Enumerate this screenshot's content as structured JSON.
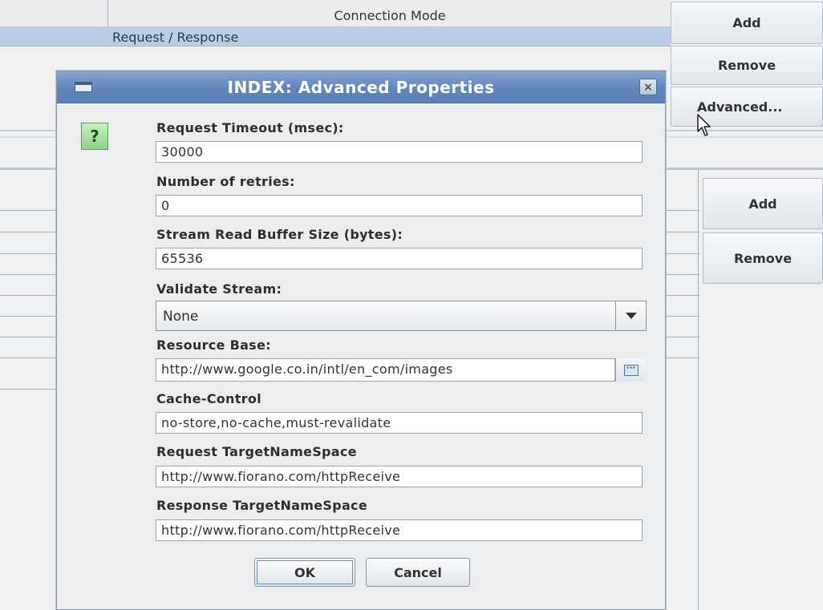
{
  "background": {
    "table": {
      "column_header": "Connection Mode",
      "selected_row_value": "Request / Response"
    },
    "top_buttons": {
      "add": "Add",
      "remove": "Remove",
      "advanced": "Advanced..."
    },
    "lower_buttons": {
      "add": "Add",
      "remove": "Remove"
    }
  },
  "dialog": {
    "title": "INDEX: Advanced Properties",
    "close_glyph": "×",
    "question_glyph": "?",
    "fields": {
      "request_timeout": {
        "label": "Request Timeout (msec):",
        "value": "30000"
      },
      "retries": {
        "label": "Number of retries:",
        "value": "0"
      },
      "buffer_size": {
        "label": "Stream Read Buffer Size (bytes):",
        "value": "65536"
      },
      "validate_stream": {
        "label": "Validate Stream:",
        "selected": "None"
      },
      "resource_base": {
        "label": "Resource Base:",
        "value": "http://www.google.co.in/intl/en_com/images",
        "browse_glyph": "···"
      },
      "cache_control": {
        "label": "Cache-Control",
        "value": "no-store,no-cache,must-revalidate"
      },
      "request_ns": {
        "label": "Request TargetNameSpace",
        "value": "http://www.fiorano.com/httpReceive"
      },
      "response_ns": {
        "label": "Response TargetNameSpace",
        "value": "http://www.fiorano.com/httpReceive"
      }
    },
    "buttons": {
      "ok": "OK",
      "cancel": "Cancel"
    }
  },
  "colors": {
    "title_bar": "#5f85bb",
    "selected_row": "#b9cde6",
    "help_icon": "#8fd28a"
  }
}
